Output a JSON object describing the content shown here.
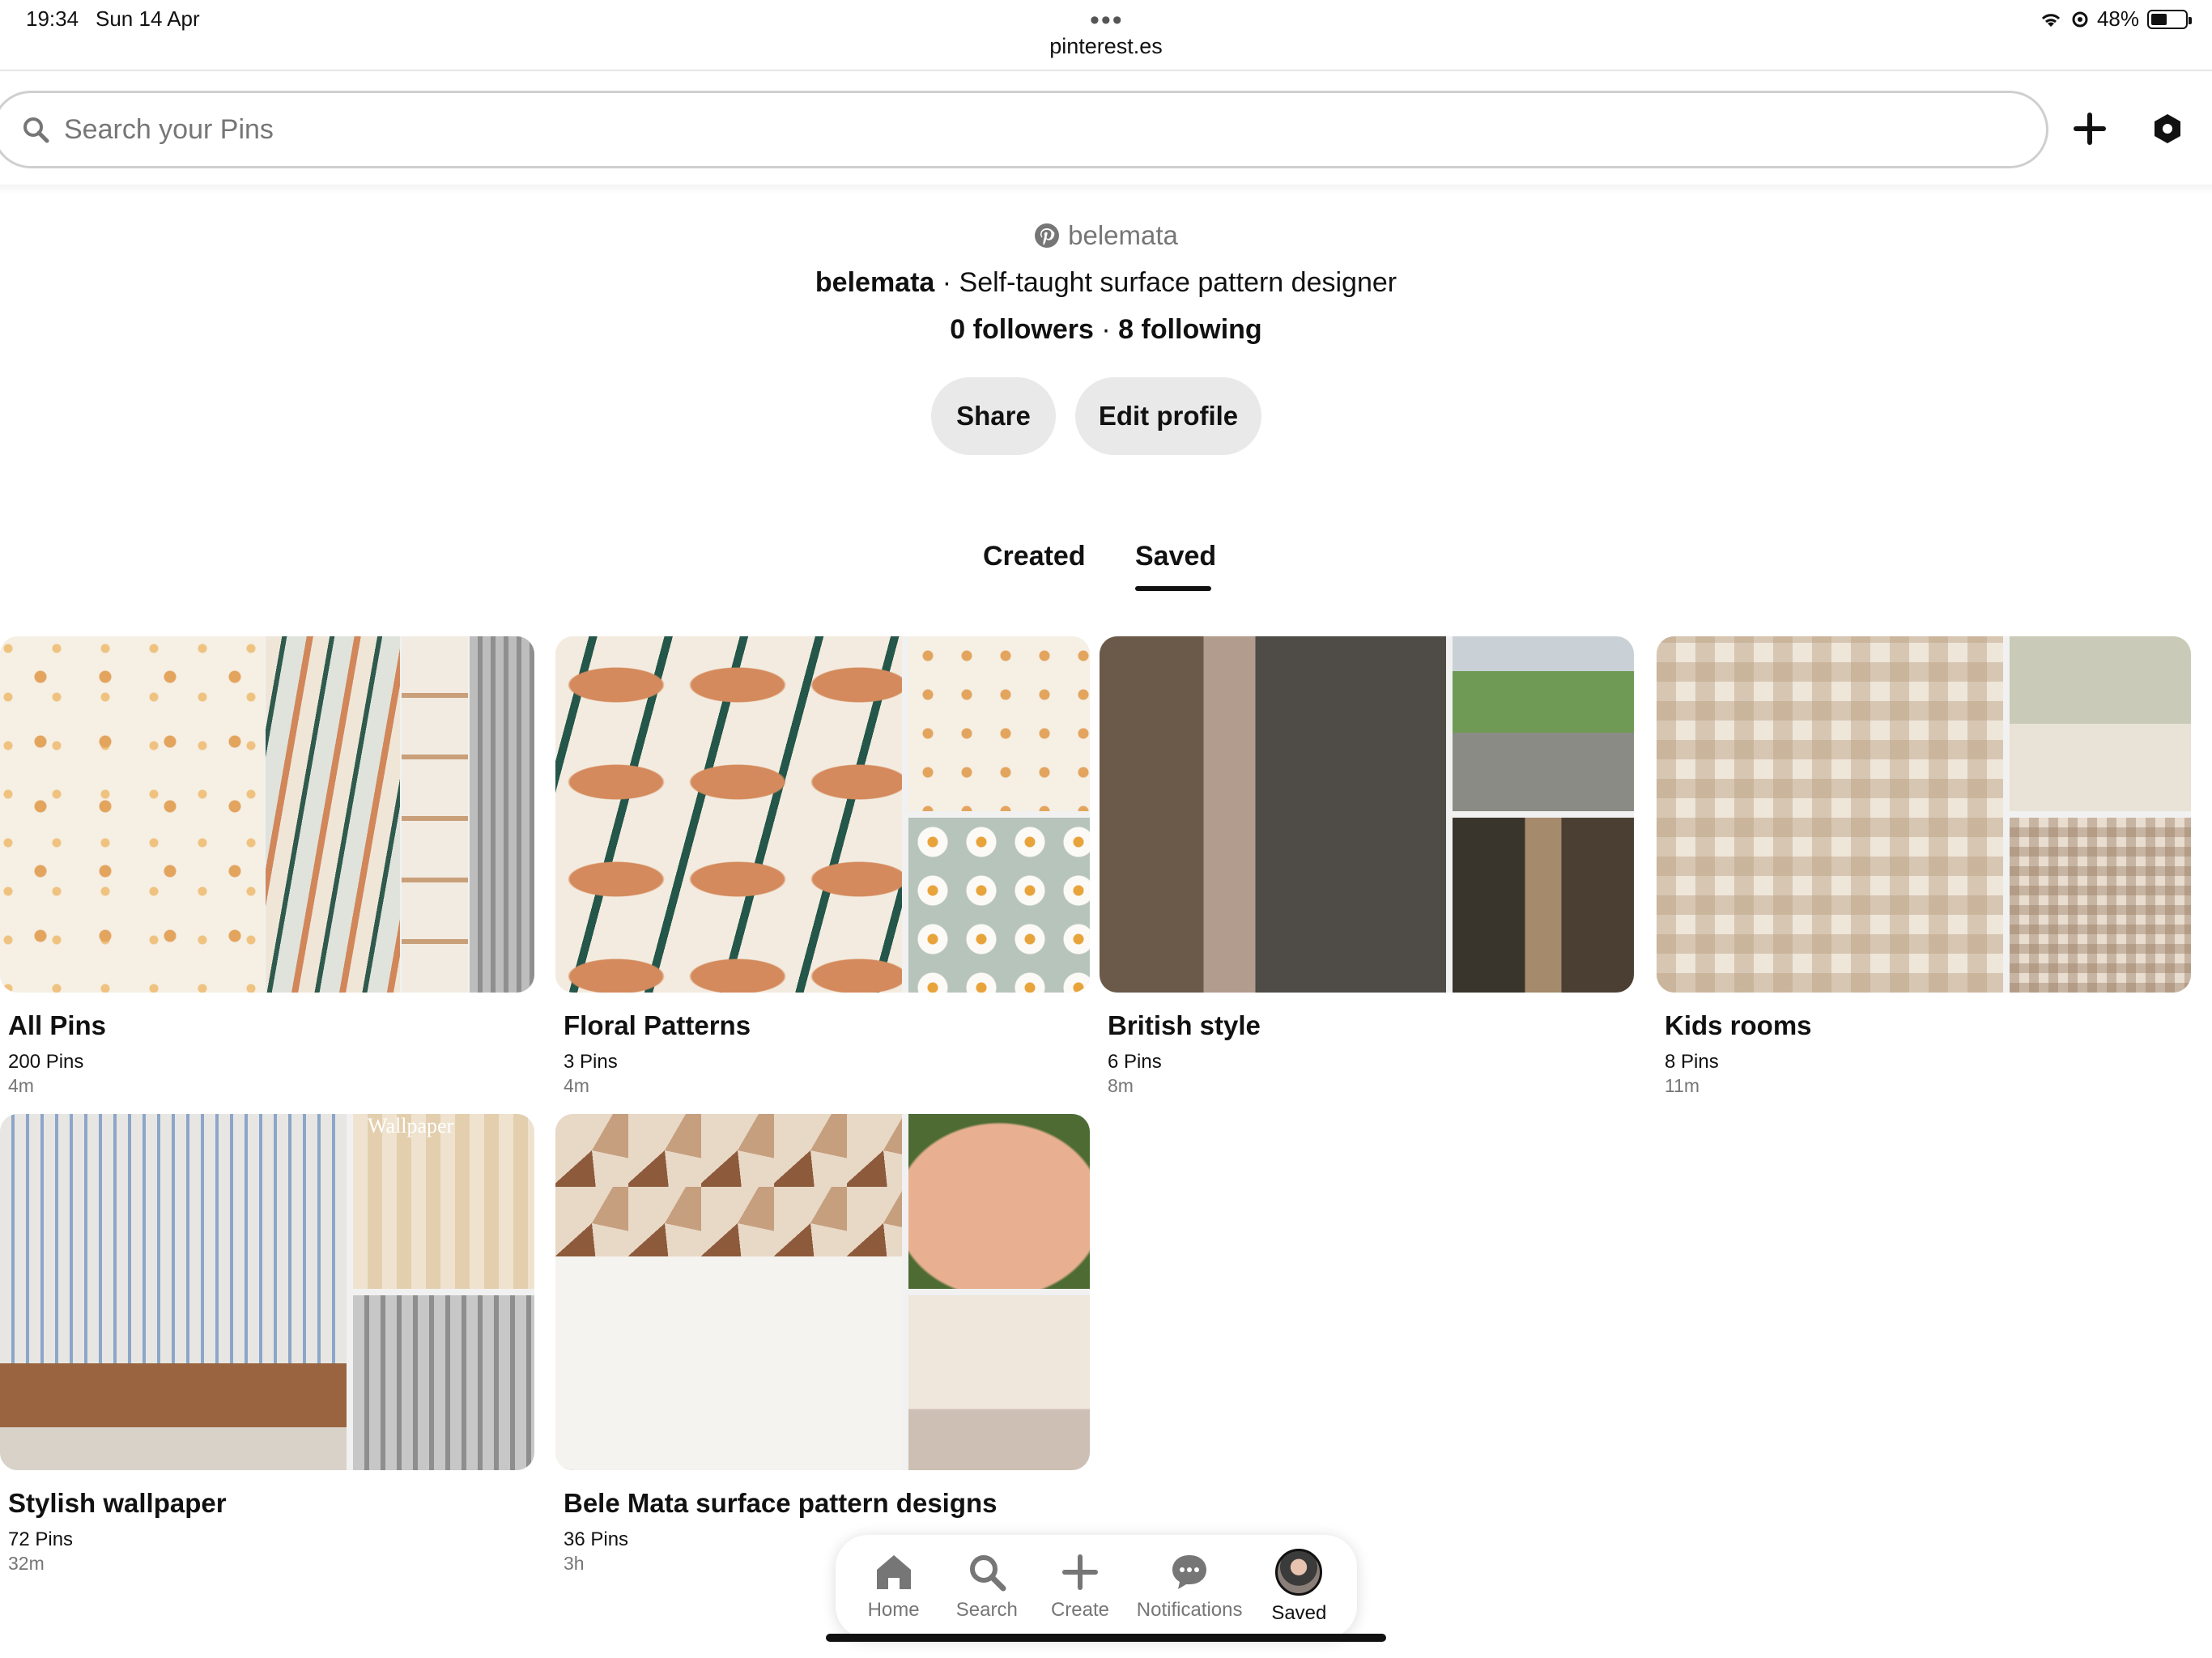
{
  "status_bar": {
    "time": "19:34",
    "date": "Sun 14 Apr",
    "url": "pinterest.es",
    "battery": "48%",
    "battery_level": 0.48
  },
  "search": {
    "placeholder": "Search your Pins"
  },
  "profile": {
    "handle": "belemata",
    "name": "belemata",
    "bio": "· Self-taught surface pattern designer",
    "followers": "0 followers",
    "separator": "·",
    "following": "8 following"
  },
  "buttons": {
    "share": "Share",
    "edit_profile": "Edit profile"
  },
  "tabs": {
    "created": "Created",
    "saved": "Saved"
  },
  "boards": [
    {
      "title": "All Pins",
      "count": "200 Pins",
      "time": "4m"
    },
    {
      "title": "Floral Patterns",
      "count": "3 Pins",
      "time": "4m"
    },
    {
      "title": "British style",
      "count": "6 Pins",
      "time": "8m"
    },
    {
      "title": "Kids rooms",
      "count": "8 Pins",
      "time": "11m"
    },
    {
      "title": "Stylish wallpaper",
      "count": "72 Pins",
      "time": "32m",
      "image_text": "Wallpaper"
    },
    {
      "title": "Bele Mata surface pattern designs",
      "count": "36 Pins",
      "time": "3h"
    }
  ],
  "nav": {
    "home": "Home",
    "search": "Search",
    "create": "Create",
    "notifications": "Notifications",
    "saved": "Saved"
  },
  "colors": {
    "text": "#111111",
    "muted": "#767676",
    "pill": "#e9e9e9"
  }
}
